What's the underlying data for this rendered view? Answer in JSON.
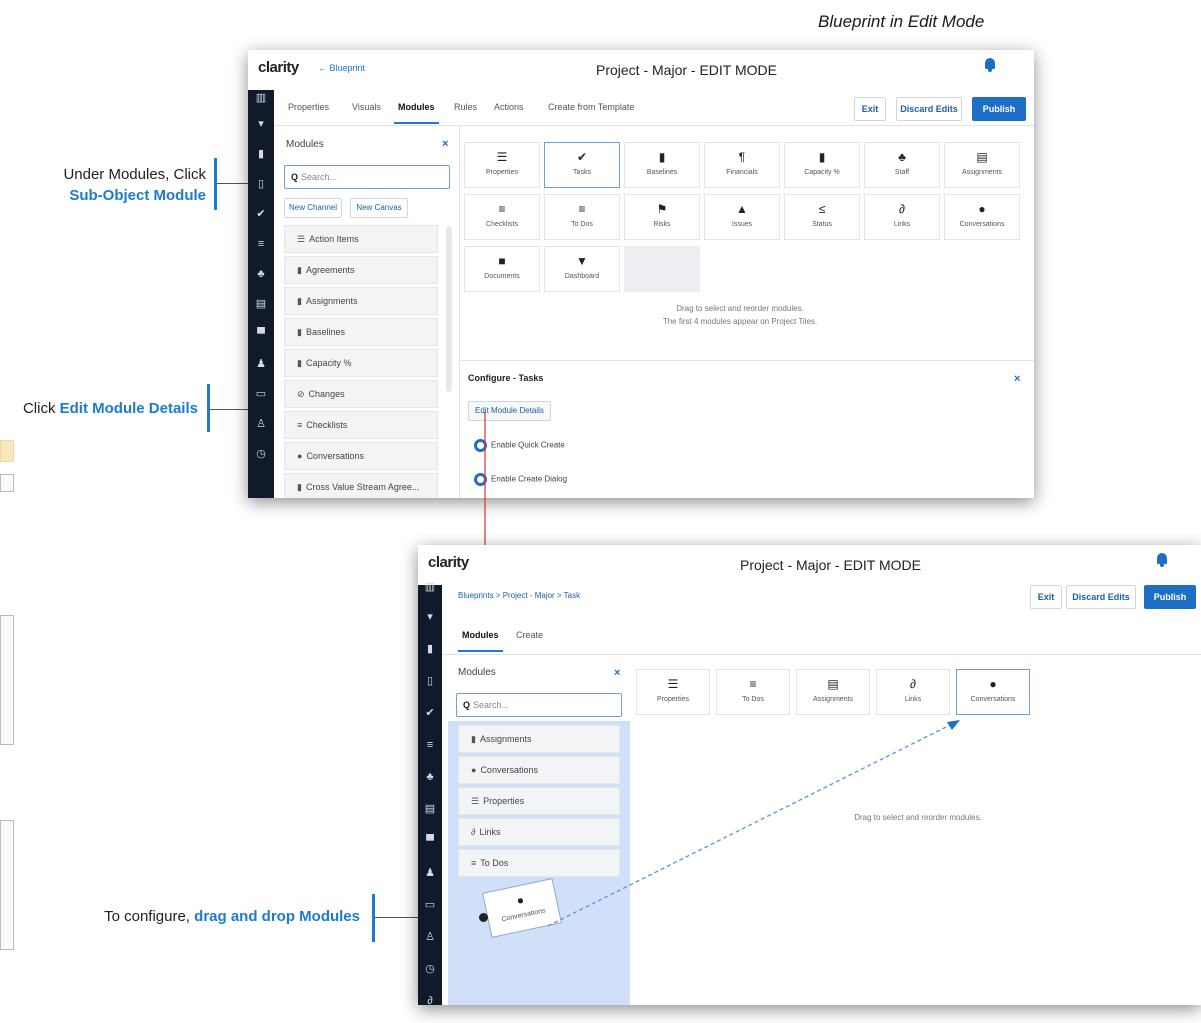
{
  "heading": "Blueprint in Edit Mode",
  "callouts": {
    "first": {
      "line1": "Under Modules, Click",
      "line2": "Sub-Object Module"
    },
    "second": {
      "prefix": "Click ",
      "emph": "Edit Module Details"
    },
    "third": {
      "prefix": "To configure, ",
      "emph": "drag and drop Modules"
    }
  },
  "window1": {
    "logo": "clarity",
    "back_link": "← Blueprint",
    "title": "Project - Major - EDIT MODE",
    "tabs": [
      "Properties",
      "Visuals",
      "Modules",
      "Rules",
      "Actions",
      "Create from Template"
    ],
    "active_tab": "Modules",
    "buttons": {
      "exit": "Exit",
      "discard": "Discard Edits",
      "publish": "Publish"
    },
    "modules_panel": {
      "title": "Modules",
      "search_placeholder": "Search...",
      "new_channel": "New Channel",
      "new_canvas": "New Canvas",
      "items": [
        {
          "icon": "☰",
          "label": "Action Items"
        },
        {
          "icon": "▮",
          "label": "Agreements"
        },
        {
          "icon": "▮",
          "label": "Assignments"
        },
        {
          "icon": "▮",
          "label": "Baselines"
        },
        {
          "icon": "▮",
          "label": "Capacity %"
        },
        {
          "icon": "⊘",
          "label": "Changes"
        },
        {
          "icon": "≡",
          "label": "Checklists"
        },
        {
          "icon": "●",
          "label": "Conversations"
        },
        {
          "icon": "▮",
          "label": "Cross Value Stream Agree..."
        }
      ]
    },
    "tiles": [
      {
        "icon": "☰",
        "label": "Properties"
      },
      {
        "icon": "✔",
        "label": "Tasks"
      },
      {
        "icon": "▮",
        "label": "Baselines"
      },
      {
        "icon": "¶",
        "label": "Financials"
      },
      {
        "icon": "▮",
        "label": "Capacity %"
      },
      {
        "icon": "♣",
        "label": "Staff"
      },
      {
        "icon": "▤",
        "label": "Assignments"
      },
      {
        "icon": "≡",
        "label": "Checklists"
      },
      {
        "icon": "≡",
        "label": "To Dos"
      },
      {
        "icon": "⚑",
        "label": "Risks"
      },
      {
        "icon": "▲",
        "label": "Issues"
      },
      {
        "icon": "≤",
        "label": "Status"
      },
      {
        "icon": "∂",
        "label": "Links"
      },
      {
        "icon": "●",
        "label": "Conversations"
      },
      {
        "icon": "■",
        "label": "Documents"
      },
      {
        "icon": "▼",
        "label": "Dashboard"
      }
    ],
    "hint_line1": "Drag to select and reorder modules.",
    "hint_line2": "The first 4 modules appear on Project Tiles.",
    "configure_title": "Configure - Tasks",
    "edit_details": "Edit Module Details",
    "toggle1": "Enable Quick Create",
    "toggle2": "Enable Create Dialog"
  },
  "window2": {
    "logo": "clarity",
    "title": "Project - Major - EDIT MODE",
    "breadcrumb": "Blueprints > Project - Major > Task",
    "tabs": [
      "Modules",
      "Create"
    ],
    "buttons": {
      "exit": "Exit",
      "discard": "Discard Edits",
      "publish": "Publish"
    },
    "modules_panel": {
      "title": "Modules",
      "search_placeholder": "Search...",
      "items": [
        {
          "icon": "▮",
          "label": "Assignments"
        },
        {
          "icon": "●",
          "label": "Conversations"
        },
        {
          "icon": "☰",
          "label": "Properties"
        },
        {
          "icon": "∂",
          "label": "Links"
        },
        {
          "icon": "≡",
          "label": "To Dos"
        }
      ]
    },
    "tiles": [
      {
        "icon": "☰",
        "label": "Properties"
      },
      {
        "icon": "≡",
        "label": "To Dos"
      },
      {
        "icon": "▤",
        "label": "Assignments"
      },
      {
        "icon": "∂",
        "label": "Links"
      },
      {
        "icon": "●",
        "label": "Conversations"
      }
    ],
    "dragging_tile": {
      "icon": "●",
      "label": "Conversations"
    },
    "hint": "Drag to select and reorder modules."
  },
  "colors": {
    "accent": "#1c7bd0",
    "nav": "#111a2b",
    "primary_button": "#1c6fc4",
    "drop_zone": "#cfe0f8",
    "arrow": "#e03030"
  }
}
